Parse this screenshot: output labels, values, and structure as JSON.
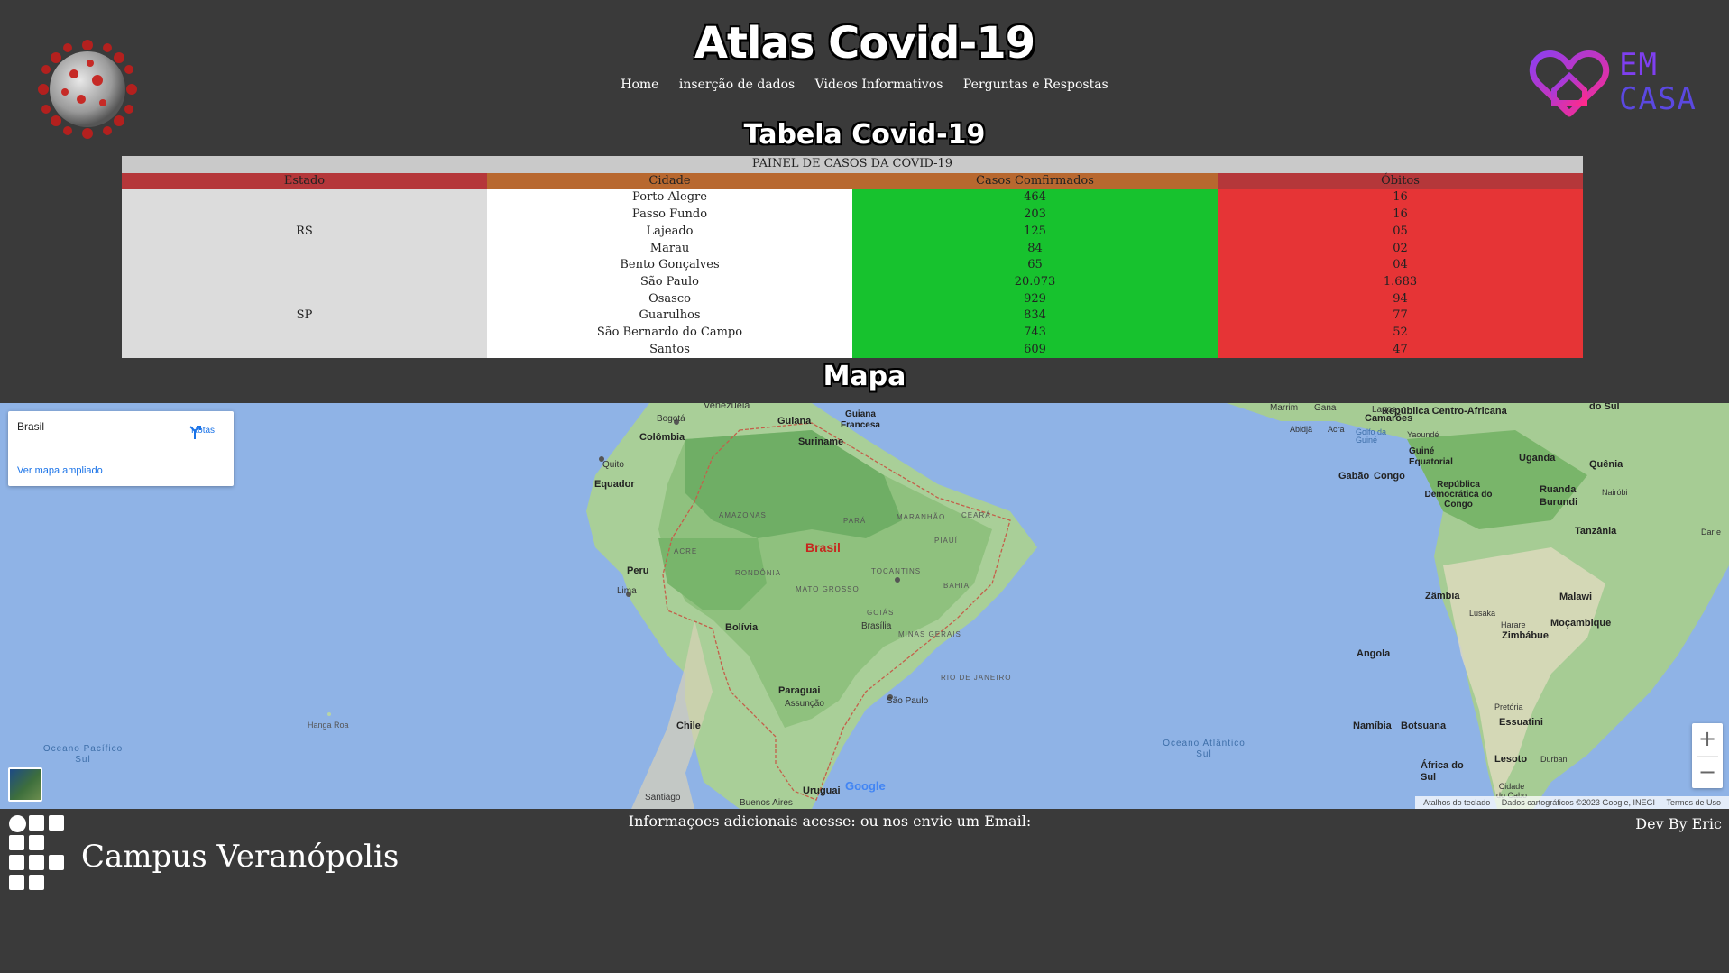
{
  "header": {
    "title": "Atlas Covid-19",
    "nav": [
      "Home",
      "inserção de dados",
      "Videos Informativos",
      "Perguntas e Respostas"
    ],
    "logo_right": {
      "line1": "EM",
      "line2": "CASA"
    }
  },
  "table_section": {
    "title": "Tabela Covid-19",
    "caption": "PAINEL DE CASOS DA COVID-19",
    "headers": [
      "Estado",
      "Cidade",
      "Casos Comfirmados",
      "Óbitos"
    ],
    "groups": [
      {
        "estado": "RS",
        "rows": [
          [
            "Porto Alegre",
            "464",
            "16"
          ],
          [
            "Passo Fundo",
            "203",
            "16"
          ],
          [
            "Lajeado",
            "125",
            "05"
          ],
          [
            "Marau",
            "84",
            "02"
          ],
          [
            "Bento Gonçalves",
            "65",
            "04"
          ]
        ]
      },
      {
        "estado": "SP",
        "rows": [
          [
            "São Paulo",
            "20.073",
            "1.683"
          ],
          [
            "Osasco",
            "929",
            "94"
          ],
          [
            "Guarulhos",
            "834",
            "77"
          ],
          [
            "São Bernardo do Campo",
            "743",
            "52"
          ],
          [
            "Santos",
            "609",
            "47"
          ]
        ]
      }
    ]
  },
  "map_section": {
    "title": "Mapa",
    "card": {
      "place": "Brasil",
      "route_label": "Rotas",
      "larger_map": "Ver mapa ampliado"
    },
    "labels": {
      "brasil": "Brasil",
      "venezuela": "Venezuela",
      "colombia": "Colômbia",
      "bogota": "Bogotá",
      "quito": "Quito",
      "equador": "Equador",
      "peru": "Peru",
      "lima": "Lima",
      "bolivia": "Bolívia",
      "chile": "Chile",
      "paraguai": "Paraguai",
      "assuncao": "Assunção",
      "uruguai": "Uruguai",
      "santiago": "Santiago",
      "buenos_aires": "Buenos Aires",
      "guiana": "Guiana",
      "suriname": "Suriname",
      "guiana_francesa": "Guiana Francesa",
      "brasilia": "Brasília",
      "sao_paulo": "São Paulo",
      "rio_de_janeiro": "RIO DE JANEIRO",
      "amazonas": "AMAZONAS",
      "para": "PARÁ",
      "acre": "ACRE",
      "rondonia": "RONDÔNIA",
      "mato_grosso": "MATO GROSSO",
      "goias": "GOIÁS",
      "bahia": "BAHIA",
      "tocantins": "TOCANTINS",
      "maranhao": "MARANHÃO",
      "piaui": "PIAUÍ",
      "ceara": "CEARÁ",
      "minas_gerais": "MINAS GERAIS",
      "oceano_pacifico": "Oceano Pacífico Sul",
      "oceano_atlantico": "Oceano Atlântico Sul",
      "hanga_roa": "Hanga Roa",
      "angola": "Angola",
      "zambia": "Zâmbia",
      "namibia": "Namíbia",
      "botsuana": "Botsuana",
      "africa_do_sul": "África do Sul",
      "congo": "Congo",
      "rdc": "República Democrática do Congo",
      "gabao": "Gabão",
      "camaroes": "Camarões",
      "uganda": "Uganda",
      "quenia": "Quênia",
      "tanzania": "Tanzânia",
      "malawi": "Malawi",
      "mocambique": "Moçambique",
      "zimbabue": "Zimbábue",
      "lagos": "Lagos",
      "abidja": "Abidjã",
      "acra": "Acra",
      "rep_centro_africana": "República Centro-Africana",
      "golfo_guine": "Golfo da Guiné",
      "guine_equatorial": "Guiné Equatorial",
      "ruanda": "Ruanda",
      "burundi": "Burundi",
      "lusaka": "Lusaka",
      "harare": "Harare",
      "pretoria": "Pretória",
      "lesoto": "Lesoto",
      "durban": "Durban",
      "essuatini": "Essuatini",
      "nairobi": "Nairóbi",
      "yaounde": "Yaoundé",
      "dar": "Dar e",
      "cidade_do_cabo": "Cidade do Cabo",
      "mali": "Marrim",
      "gana": "Gana",
      "do_sul": "do Sul"
    },
    "attribution": [
      "Atalhos do teclado",
      "Dados cartográficos ©2023 Google, INEGI",
      "Termos de Uso"
    ],
    "google": "Google"
  },
  "footer": {
    "info": "Informaçoes adicionais acesse: ou nos envie um Email:",
    "dev": "Dev By Eric",
    "campus": "Campus Veranópolis"
  }
}
